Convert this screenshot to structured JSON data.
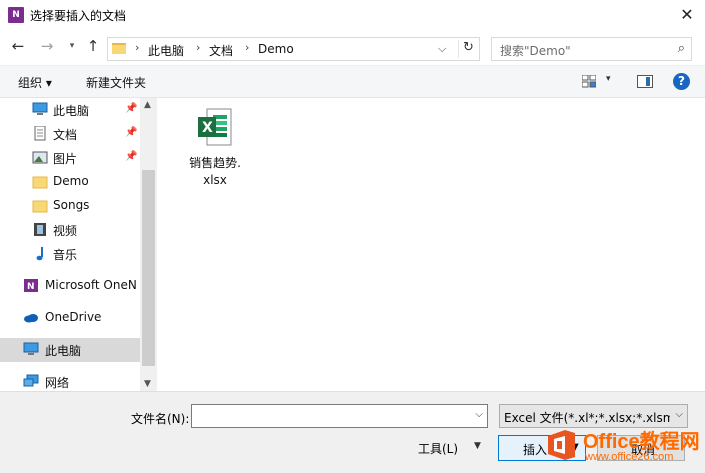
{
  "window": {
    "title": "选择要插入的文档",
    "app_icon_text": "N",
    "close_glyph": "✕"
  },
  "nav": {
    "back_glyph": "←",
    "forward_glyph": "→",
    "recent_glyph": "▾",
    "up_glyph": "↑",
    "breadcrumb": [
      "此电脑",
      "文档",
      "Demo"
    ],
    "separator_glyph": "›",
    "address_dropdown_glyph": "⌵",
    "refresh_glyph": "↻",
    "search_placeholder": "搜索\"Demo\"",
    "search_glyph": "⌕"
  },
  "toolbar": {
    "organize": "组织 ▾",
    "new_folder": "新建文件夹",
    "view_dropdown_glyph": "▾",
    "help_glyph": "?"
  },
  "sidebar": {
    "pin_glyph": "📌",
    "items": [
      {
        "label": "此电脑",
        "icon": "computer-icon",
        "pinned": true
      },
      {
        "label": "文档",
        "icon": "document-icon",
        "pinned": true
      },
      {
        "label": "图片",
        "icon": "picture-icon",
        "pinned": true
      },
      {
        "label": "Demo",
        "icon": "folder-icon",
        "pinned": false
      },
      {
        "label": "Songs",
        "icon": "folder-icon",
        "pinned": false
      },
      {
        "label": "视频",
        "icon": "video-icon",
        "pinned": false
      },
      {
        "label": "音乐",
        "icon": "music-icon",
        "pinned": false
      },
      {
        "label": "Microsoft OneN",
        "icon": "onenote-icon",
        "pinned": false
      },
      {
        "label": "OneDrive",
        "icon": "onedrive-icon",
        "pinned": false
      },
      {
        "label": "此电脑",
        "icon": "computer-icon",
        "pinned": false,
        "selected": true
      },
      {
        "label": "网络",
        "icon": "network-icon",
        "pinned": false
      }
    ],
    "scroll_up_glyph": "▲",
    "scroll_down_glyph": "▼"
  },
  "files": [
    {
      "name_line1": "销售趋势.",
      "name_line2": "xlsx",
      "icon": "excel-file-icon",
      "icon_letter": "X"
    }
  ],
  "bottom": {
    "filename_label": "文件名(N):",
    "filename_value": "",
    "filename_dropdown_glyph": "⌵",
    "filter_value": "Excel 文件(*.xl*;*.xlsx;*.xlsm;*.",
    "filter_dropdown_glyph": "⌵",
    "tools_label": "工具(L)",
    "tools_dropdown_glyph": "▼",
    "insert_label": "插入",
    "insert_dropdown_glyph": "▼",
    "cancel_label": "取消"
  },
  "watermark": {
    "title": "Office教程网",
    "url": "www.office26.com"
  },
  "colors": {
    "accent": "#0078d7",
    "excel_green": "#1d6f42",
    "folder_yellow": "#f8d775",
    "onenote_purple": "#7b2c8f",
    "watermark_orange": "#ff6a00"
  }
}
